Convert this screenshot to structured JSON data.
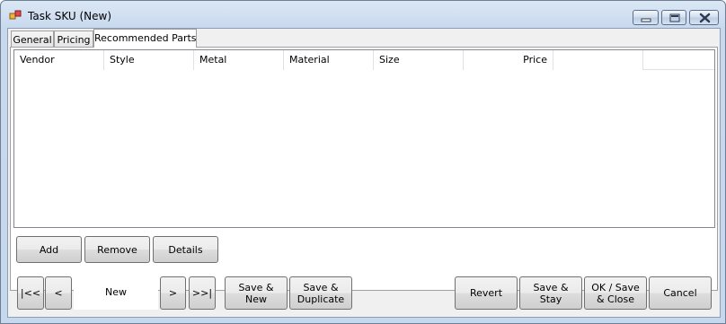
{
  "window": {
    "title": "Task SKU (New)",
    "icon": "app-form-icon",
    "controls": {
      "minimize": "minimize-icon",
      "maximize": "maximize-icon",
      "close": "close-icon"
    }
  },
  "tabs": [
    {
      "label": "General",
      "active": false
    },
    {
      "label": "Pricing",
      "active": false
    },
    {
      "label": "Recommended Parts",
      "active": true
    }
  ],
  "grid": {
    "columns": [
      "Vendor",
      "Style",
      "Metal",
      "Material",
      "Size",
      "Price",
      ""
    ],
    "rows": []
  },
  "parts_buttons": {
    "add": "Add",
    "remove": "Remove",
    "details": "Details"
  },
  "navigator": {
    "first": "|<<",
    "prev": "<",
    "record": "New",
    "next": ">",
    "last": ">>|"
  },
  "actions": {
    "save_new": "Save &\nNew",
    "save_duplicate": "Save &\nDuplicate",
    "revert": "Revert",
    "save_stay": "Save &\nStay",
    "ok_save_close": "OK / Save\n& Close",
    "cancel": "Cancel"
  },
  "colors": {
    "title_bar": "#c8d9ee",
    "client_bg": "#f0f0f0",
    "grid_bg": "#ffffff",
    "close_button": "#c75050"
  }
}
